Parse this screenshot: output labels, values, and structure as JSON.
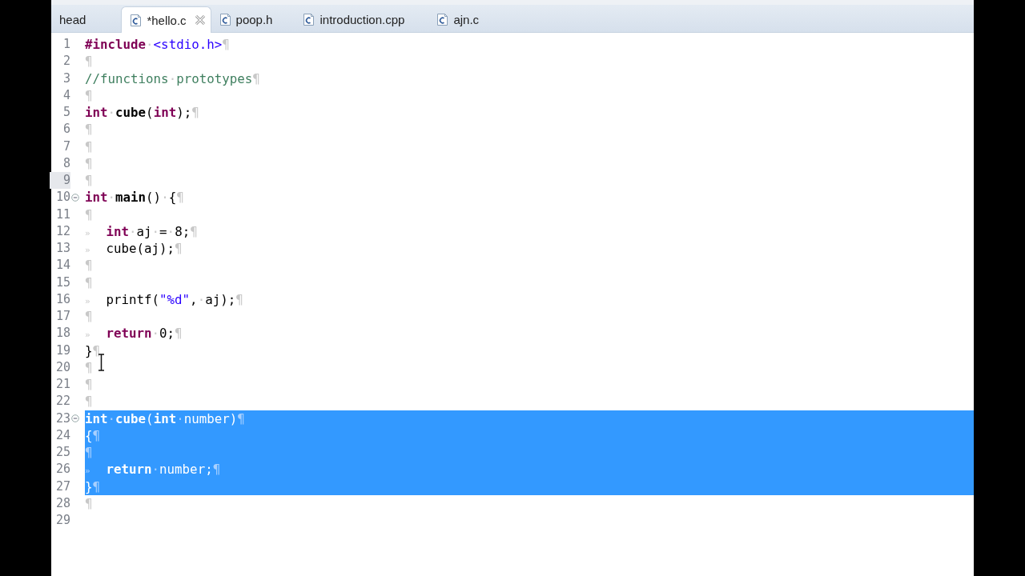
{
  "tabs": [
    {
      "label": "head",
      "selected": false
    },
    {
      "label": "*hello.c",
      "selected": true
    },
    {
      "label": "poop.h",
      "selected": false
    },
    {
      "label": "introduction.cpp",
      "selected": false
    },
    {
      "label": "ajn.c",
      "selected": false
    }
  ],
  "editor": {
    "lines": [
      {
        "number": "1",
        "foldable": false,
        "current": false,
        "selected": false,
        "tokens": [
          {
            "kind": "keyword",
            "text": "#include"
          },
          {
            "kind": "mark",
            "text": "·"
          },
          {
            "kind": "string",
            "text": "<stdio.h>"
          },
          {
            "kind": "mark",
            "text": "¶"
          }
        ]
      },
      {
        "number": "2",
        "foldable": false,
        "current": false,
        "selected": false,
        "tokens": [
          {
            "kind": "mark",
            "text": "¶"
          }
        ]
      },
      {
        "number": "3",
        "foldable": false,
        "current": false,
        "selected": false,
        "tokens": [
          {
            "kind": "comment",
            "text": "//functions"
          },
          {
            "kind": "mark",
            "text": "·"
          },
          {
            "kind": "comment",
            "text": "prototypes"
          },
          {
            "kind": "mark",
            "text": "¶"
          }
        ]
      },
      {
        "number": "4",
        "foldable": false,
        "current": false,
        "selected": false,
        "tokens": [
          {
            "kind": "mark",
            "text": "¶"
          }
        ]
      },
      {
        "number": "5",
        "foldable": false,
        "current": false,
        "selected": false,
        "tokens": [
          {
            "kind": "keyword",
            "text": "int"
          },
          {
            "kind": "mark",
            "text": "·"
          },
          {
            "kind": "name",
            "text": "cube"
          },
          {
            "kind": "plain",
            "text": "("
          },
          {
            "kind": "keyword",
            "text": "int"
          },
          {
            "kind": "plain",
            "text": ");"
          },
          {
            "kind": "mark",
            "text": "¶"
          }
        ]
      },
      {
        "number": "6",
        "foldable": false,
        "current": false,
        "selected": false,
        "tokens": [
          {
            "kind": "mark",
            "text": "¶"
          }
        ]
      },
      {
        "number": "7",
        "foldable": false,
        "current": false,
        "selected": false,
        "tokens": [
          {
            "kind": "mark",
            "text": "¶"
          }
        ]
      },
      {
        "number": "8",
        "foldable": false,
        "current": false,
        "selected": false,
        "tokens": [
          {
            "kind": "mark",
            "text": "¶"
          }
        ]
      },
      {
        "number": "9",
        "foldable": false,
        "current": true,
        "selected": false,
        "tokens": [
          {
            "kind": "mark",
            "text": "¶"
          }
        ]
      },
      {
        "number": "10",
        "foldable": true,
        "current": false,
        "selected": false,
        "tokens": [
          {
            "kind": "keyword",
            "text": "int"
          },
          {
            "kind": "mark",
            "text": "·"
          },
          {
            "kind": "name",
            "text": "main"
          },
          {
            "kind": "plain",
            "text": "()"
          },
          {
            "kind": "mark",
            "text": "·"
          },
          {
            "kind": "plain",
            "text": "{"
          },
          {
            "kind": "mark",
            "text": "¶"
          }
        ]
      },
      {
        "number": "11",
        "foldable": false,
        "current": false,
        "selected": false,
        "tokens": [
          {
            "kind": "mark",
            "text": "¶"
          }
        ]
      },
      {
        "number": "12",
        "foldable": false,
        "current": false,
        "selected": false,
        "tokens": [
          {
            "kind": "tab",
            "text": "»"
          },
          {
            "kind": "keyword",
            "text": "int"
          },
          {
            "kind": "mark",
            "text": "·"
          },
          {
            "kind": "plain",
            "text": "aj"
          },
          {
            "kind": "mark",
            "text": "·"
          },
          {
            "kind": "plain",
            "text": "="
          },
          {
            "kind": "mark",
            "text": "·"
          },
          {
            "kind": "plain",
            "text": "8;"
          },
          {
            "kind": "mark",
            "text": "¶"
          }
        ]
      },
      {
        "number": "13",
        "foldable": false,
        "current": false,
        "selected": false,
        "tokens": [
          {
            "kind": "tab",
            "text": "»"
          },
          {
            "kind": "plain",
            "text": "cube(aj);"
          },
          {
            "kind": "mark",
            "text": "¶"
          }
        ]
      },
      {
        "number": "14",
        "foldable": false,
        "current": false,
        "selected": false,
        "tokens": [
          {
            "kind": "mark",
            "text": "¶"
          }
        ]
      },
      {
        "number": "15",
        "foldable": false,
        "current": false,
        "selected": false,
        "tokens": [
          {
            "kind": "mark",
            "text": "¶"
          }
        ]
      },
      {
        "number": "16",
        "foldable": false,
        "current": false,
        "selected": false,
        "tokens": [
          {
            "kind": "tab",
            "text": "»"
          },
          {
            "kind": "plain",
            "text": "printf("
          },
          {
            "kind": "string",
            "text": "\"%d\""
          },
          {
            "kind": "plain",
            "text": ","
          },
          {
            "kind": "mark",
            "text": "·"
          },
          {
            "kind": "plain",
            "text": "aj);"
          },
          {
            "kind": "mark",
            "text": "¶"
          }
        ]
      },
      {
        "number": "17",
        "foldable": false,
        "current": false,
        "selected": false,
        "tokens": [
          {
            "kind": "mark",
            "text": "¶"
          }
        ]
      },
      {
        "number": "18",
        "foldable": false,
        "current": false,
        "selected": false,
        "tokens": [
          {
            "kind": "tab",
            "text": "»"
          },
          {
            "kind": "keyword",
            "text": "return"
          },
          {
            "kind": "mark",
            "text": "·"
          },
          {
            "kind": "plain",
            "text": "0;"
          },
          {
            "kind": "mark",
            "text": "¶"
          }
        ]
      },
      {
        "number": "19",
        "foldable": false,
        "current": false,
        "selected": false,
        "tokens": [
          {
            "kind": "plain",
            "text": "}"
          },
          {
            "kind": "mark",
            "text": "¶"
          }
        ]
      },
      {
        "number": "20",
        "foldable": false,
        "current": false,
        "selected": false,
        "tokens": [
          {
            "kind": "mark",
            "text": "¶"
          }
        ]
      },
      {
        "number": "21",
        "foldable": false,
        "current": false,
        "selected": false,
        "tokens": [
          {
            "kind": "mark",
            "text": "¶"
          }
        ]
      },
      {
        "number": "22",
        "foldable": false,
        "current": false,
        "selected": false,
        "tokens": [
          {
            "kind": "mark",
            "text": "¶"
          }
        ]
      },
      {
        "number": "23",
        "foldable": true,
        "current": false,
        "selected": true,
        "tokens": [
          {
            "kind": "keyword",
            "text": "int"
          },
          {
            "kind": "mark",
            "text": "·"
          },
          {
            "kind": "name",
            "text": "cube"
          },
          {
            "kind": "plain",
            "text": "("
          },
          {
            "kind": "keyword",
            "text": "int"
          },
          {
            "kind": "mark",
            "text": "·"
          },
          {
            "kind": "plain",
            "text": "number)"
          },
          {
            "kind": "mark",
            "text": "¶"
          }
        ]
      },
      {
        "number": "24",
        "foldable": false,
        "current": false,
        "selected": true,
        "tokens": [
          {
            "kind": "plain",
            "text": "{"
          },
          {
            "kind": "mark",
            "text": "¶"
          }
        ]
      },
      {
        "number": "25",
        "foldable": false,
        "current": false,
        "selected": true,
        "tokens": [
          {
            "kind": "mark",
            "text": "¶"
          }
        ]
      },
      {
        "number": "26",
        "foldable": false,
        "current": false,
        "selected": true,
        "tokens": [
          {
            "kind": "tab",
            "text": "»"
          },
          {
            "kind": "keyword",
            "text": "return"
          },
          {
            "kind": "mark",
            "text": "·"
          },
          {
            "kind": "plain",
            "text": "number;"
          },
          {
            "kind": "mark",
            "text": "¶"
          }
        ]
      },
      {
        "number": "27",
        "foldable": false,
        "current": false,
        "selected": true,
        "tokens": [
          {
            "kind": "plain",
            "text": "}"
          },
          {
            "kind": "mark",
            "text": "¶"
          }
        ]
      },
      {
        "number": "28",
        "foldable": false,
        "current": false,
        "selected": false,
        "tokens": [
          {
            "kind": "mark",
            "text": "¶"
          }
        ]
      },
      {
        "number": "29",
        "foldable": false,
        "current": false,
        "selected": false
      }
    ]
  }
}
